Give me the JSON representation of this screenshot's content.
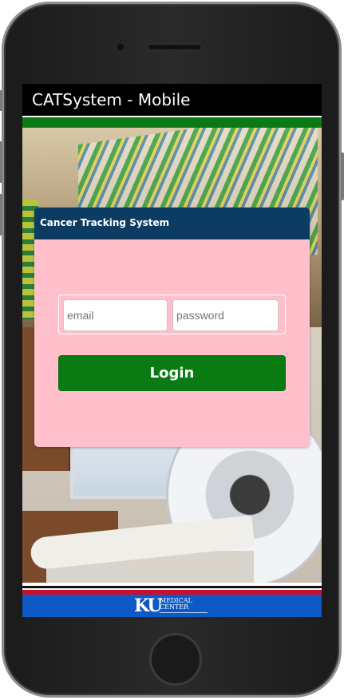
{
  "app": {
    "title": "CATSystem - Mobile"
  },
  "login": {
    "card_title": "Cancer Tracking System",
    "email_placeholder": "email",
    "password_placeholder": "password",
    "button_label": "Login"
  },
  "footer": {
    "logo_mark": "KU",
    "logo_line1": "MEDICAL",
    "logo_line2": "CENTER"
  },
  "colors": {
    "header_bg": "#000000",
    "accent_green": "#0a7a12",
    "card_bg": "#ffc0cb",
    "card_header_bg": "#0d3c63",
    "footer_red": "#c8102e",
    "footer_blue": "#0d59c6"
  }
}
